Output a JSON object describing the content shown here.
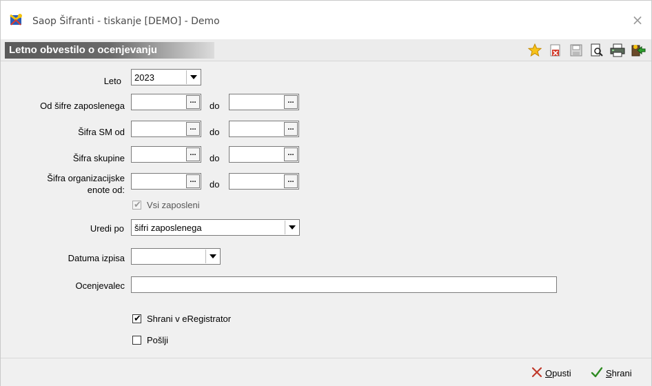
{
  "window": {
    "title": "Saop Šifranti - tiskanje [DEMO] - Demo",
    "close_glyph": "×"
  },
  "header": {
    "title": "Letno obvestilo o ocenjevanju"
  },
  "toolbar": {
    "icons": [
      "star-icon",
      "delete-icon",
      "save-icon",
      "print-preview-icon",
      "print-icon",
      "exit-icon"
    ]
  },
  "form": {
    "leto": {
      "label": "Leto",
      "value": "2023"
    },
    "od_sifre_zaposlenega": {
      "label": "Od šifre zaposlenega",
      "do": "do",
      "from": "",
      "to": ""
    },
    "sifra_sm": {
      "label": "Šifra SM od",
      "do": "do",
      "from": "",
      "to": ""
    },
    "sifra_skupine": {
      "label": "Šifra skupine",
      "do": "do",
      "from": "",
      "to": ""
    },
    "sifra_org": {
      "label_line1": "Šifra organizacijske",
      "label_line2": "enote od:",
      "do": "do",
      "from": "",
      "to": ""
    },
    "vsi_zaposleni": {
      "label": "Vsi zaposleni",
      "checked": true,
      "disabled": true
    },
    "uredi_po": {
      "label": "Uredi po",
      "value": "šifri zaposlenega"
    },
    "datuma_izpisa": {
      "label": "Datuma izpisa",
      "value": ""
    },
    "ocenjevalec": {
      "label": "Ocenjevalec",
      "value": ""
    },
    "shrani_eregistrator": {
      "label": "Shrani v eRegistrator",
      "checked": true
    },
    "poslji": {
      "label": "Pošlji",
      "checked": false
    },
    "dots": "...",
    "check_mark": "✔"
  },
  "footer": {
    "cancel": {
      "underlined": "O",
      "rest": "pusti"
    },
    "save": {
      "underlined": "S",
      "rest": "hrani"
    }
  },
  "colors": {
    "header_gradient_start": "#5a5a5a",
    "cancel_x": "#c0392b",
    "save_check": "#2e8b22"
  }
}
